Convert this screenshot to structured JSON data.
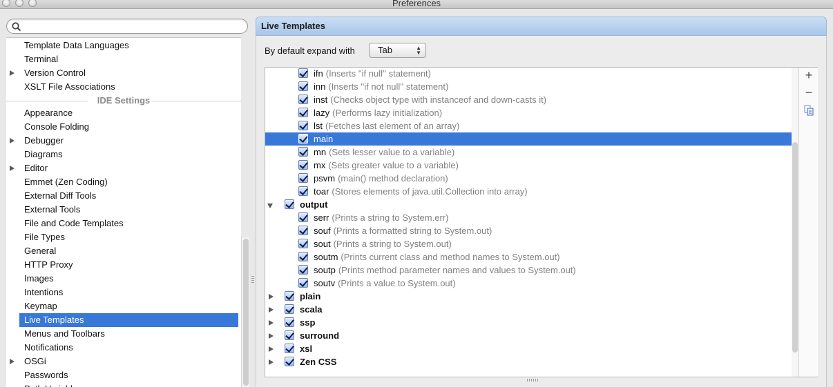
{
  "window": {
    "title": "Preferences"
  },
  "search": {
    "placeholder": ""
  },
  "sidebar": {
    "items_before": [
      {
        "label": "Template Data Languages",
        "expandable": false
      },
      {
        "label": "Terminal",
        "expandable": false
      },
      {
        "label": "Version Control",
        "expandable": true
      },
      {
        "label": "XSLT File Associations",
        "expandable": false
      }
    ],
    "section_header": "IDE Settings",
    "items_after": [
      {
        "label": "Appearance",
        "expandable": false
      },
      {
        "label": "Console Folding",
        "expandable": false
      },
      {
        "label": "Debugger",
        "expandable": true
      },
      {
        "label": "Diagrams",
        "expandable": false
      },
      {
        "label": "Editor",
        "expandable": true
      },
      {
        "label": "Emmet (Zen Coding)",
        "expandable": false
      },
      {
        "label": "External Diff Tools",
        "expandable": false
      },
      {
        "label": "External Tools",
        "expandable": false
      },
      {
        "label": "File and Code Templates",
        "expandable": false
      },
      {
        "label": "File Types",
        "expandable": false
      },
      {
        "label": "General",
        "expandable": false
      },
      {
        "label": "HTTP Proxy",
        "expandable": false
      },
      {
        "label": "Images",
        "expandable": false
      },
      {
        "label": "Intentions",
        "expandable": false
      },
      {
        "label": "Keymap",
        "expandable": false
      },
      {
        "label": "Live Templates",
        "expandable": false,
        "selected": true
      },
      {
        "label": "Menus and Toolbars",
        "expandable": false
      },
      {
        "label": "Notifications",
        "expandable": false
      },
      {
        "label": "OSGi",
        "expandable": true
      },
      {
        "label": "Passwords",
        "expandable": false
      },
      {
        "label": "Path Variables",
        "expandable": false
      }
    ]
  },
  "panel": {
    "title": "Live Templates",
    "expand_label": "By default expand with",
    "expand_value": "Tab"
  },
  "templates": [
    {
      "kind": "item",
      "abbr": "ifn",
      "desc": "(Inserts ''if null'' statement)"
    },
    {
      "kind": "item",
      "abbr": "inn",
      "desc": "(Inserts ''if not null'' statement)"
    },
    {
      "kind": "item",
      "abbr": "inst",
      "desc": "(Checks object type with instanceof and down-casts it)"
    },
    {
      "kind": "item",
      "abbr": "lazy",
      "desc": "(Performs lazy initialization)"
    },
    {
      "kind": "item",
      "abbr": "lst",
      "desc": "(Fetches last element of an array)"
    },
    {
      "kind": "item",
      "abbr": "main",
      "desc": "",
      "selected": true
    },
    {
      "kind": "item",
      "abbr": "mn",
      "desc": "(Sets lesser value to a variable)"
    },
    {
      "kind": "item",
      "abbr": "mx",
      "desc": "(Sets greater value to a variable)"
    },
    {
      "kind": "item",
      "abbr": "psvm",
      "desc": "(main() method declaration)"
    },
    {
      "kind": "item",
      "abbr": "toar",
      "desc": "(Stores elements of java.util.Collection into array)"
    },
    {
      "kind": "group",
      "abbr": "output",
      "expanded": true
    },
    {
      "kind": "item",
      "abbr": "serr",
      "desc": "(Prints a string to System.err)"
    },
    {
      "kind": "item",
      "abbr": "souf",
      "desc": "(Prints a formatted string to System.out)"
    },
    {
      "kind": "item",
      "abbr": "sout",
      "desc": "(Prints a string to System.out)"
    },
    {
      "kind": "item",
      "abbr": "soutm",
      "desc": "(Prints current class and method names to System.out)"
    },
    {
      "kind": "item",
      "abbr": "soutp",
      "desc": "(Prints method parameter names and values to System.out)"
    },
    {
      "kind": "item",
      "abbr": "soutv",
      "desc": "(Prints a value to System.out)"
    },
    {
      "kind": "group",
      "abbr": "plain",
      "expanded": false
    },
    {
      "kind": "group",
      "abbr": "scala",
      "expanded": false
    },
    {
      "kind": "group",
      "abbr": "ssp",
      "expanded": false
    },
    {
      "kind": "group",
      "abbr": "surround",
      "expanded": false
    },
    {
      "kind": "group",
      "abbr": "xsl",
      "expanded": false
    },
    {
      "kind": "group",
      "abbr": "Zen CSS",
      "expanded": false
    }
  ],
  "tools": {
    "add": "+",
    "remove": "−"
  },
  "colors": {
    "selection": "#3878d8",
    "header": "#b7cff0",
    "description": "#808080"
  }
}
